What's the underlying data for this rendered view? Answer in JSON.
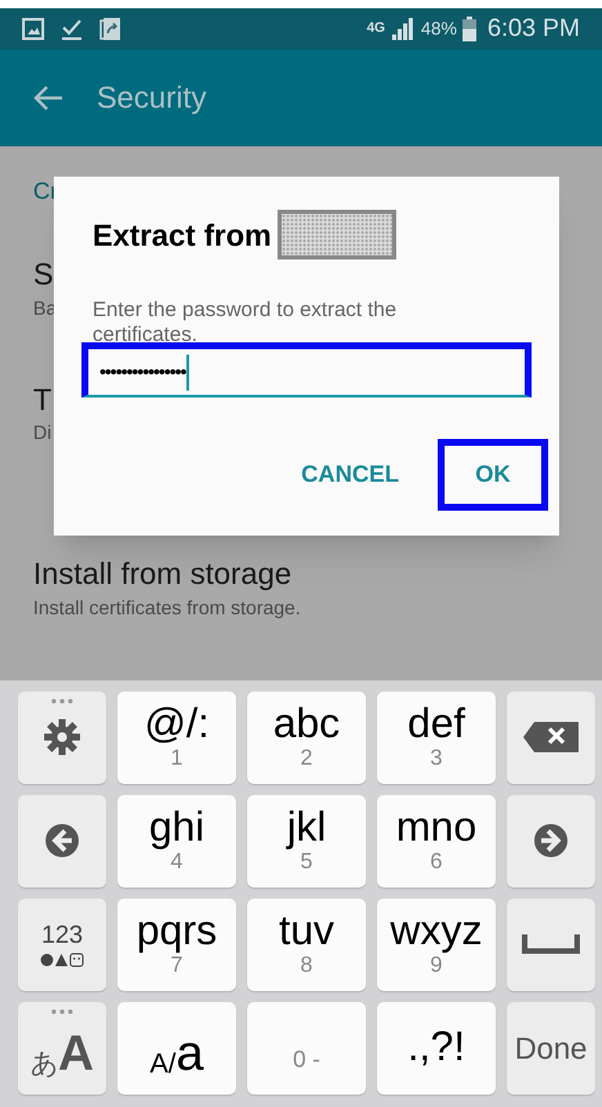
{
  "status_bar": {
    "network": "4G",
    "battery": "48%",
    "time": "6:03 PM"
  },
  "app_bar": {
    "title": "Security"
  },
  "settings_behind": [
    {
      "kind": "header",
      "text": "Cr"
    },
    {
      "kind": "item",
      "title": "S",
      "subtitle": "Ba"
    },
    {
      "kind": "item",
      "title": "T",
      "subtitle": "Di"
    },
    {
      "kind": "item",
      "title": "Install from storage",
      "subtitle": "Install certificates from storage."
    }
  ],
  "dialog": {
    "title": "Extract from",
    "message": "Enter the password to extract the certificates.",
    "password": {
      "value": "••••••••••••••••",
      "highlighted": true
    },
    "buttons": [
      {
        "label": "CANCEL",
        "highlighted": false
      },
      {
        "label": "OK",
        "highlighted": true
      }
    ]
  },
  "keyboard": {
    "rows": [
      [
        {
          "kind": "settings",
          "more": true
        },
        {
          "kind": "letters",
          "label": "@/:",
          "digit": "1"
        },
        {
          "kind": "letters",
          "label": "abc",
          "digit": "2"
        },
        {
          "kind": "letters",
          "label": "def",
          "digit": "3"
        },
        {
          "kind": "backspace",
          "more": false
        }
      ],
      [
        {
          "kind": "left",
          "more": false
        },
        {
          "kind": "letters",
          "label": "ghi",
          "digit": "4"
        },
        {
          "kind": "letters",
          "label": "jkl",
          "digit": "5"
        },
        {
          "kind": "letters",
          "label": "mno",
          "digit": "6"
        },
        {
          "kind": "right",
          "more": false
        }
      ],
      [
        {
          "kind": "mode",
          "label": "123",
          "more": false
        },
        {
          "kind": "letters",
          "label": "pqrs",
          "digit": "7"
        },
        {
          "kind": "letters",
          "label": "tuv",
          "digit": "8"
        },
        {
          "kind": "letters",
          "label": "wxyz",
          "digit": "9"
        },
        {
          "kind": "space",
          "more": false
        }
      ],
      [
        {
          "kind": "pair",
          "small": "あ",
          "big": "A",
          "more": true,
          "light": false
        },
        {
          "kind": "pair",
          "small": "A/",
          "big": "a",
          "more": false,
          "light": true
        },
        {
          "kind": "digit",
          "digit": "0 -"
        },
        {
          "kind": "letters",
          "label": ".,?!"
        },
        {
          "kind": "text",
          "label": "Done",
          "more": false
        }
      ]
    ]
  }
}
